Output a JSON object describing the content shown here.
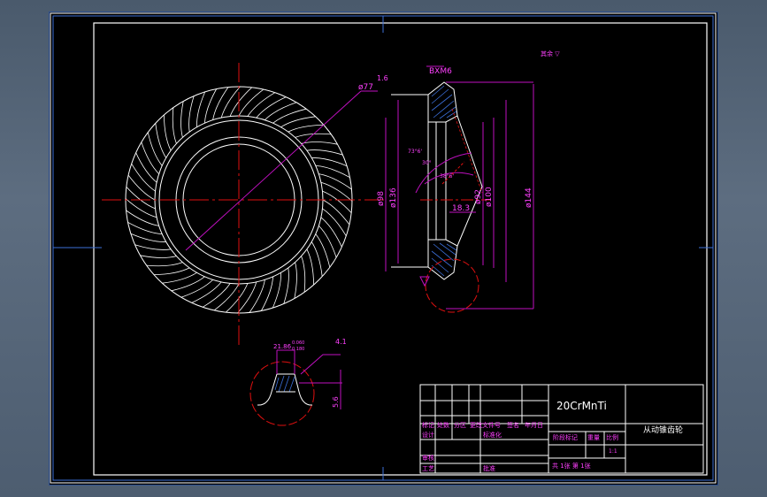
{
  "drawing": {
    "material": "20CrMnTi",
    "part_name": "从动锥齿轮",
    "tech_note": "其余 ▽",
    "surface_finish_top": "1.6",
    "chamfer": "BXM6"
  },
  "dims": {
    "d77": "ø77",
    "d98": "ø98",
    "d136": "ø136",
    "d92": "ø92",
    "d100": "ø100",
    "d144": "ø144",
    "w18": "18.3",
    "a1": "73°6'",
    "a2": "30°",
    "a3": "38°6'",
    "tooth_w": "21.86",
    "tol_up": "0.060",
    "tol_dn": "0.180",
    "d41": "4.1",
    "d56": "5.6"
  },
  "title_block": {
    "row1": [
      "标记",
      "处数",
      "分区",
      "更改文件号",
      "签名",
      "年月日"
    ],
    "row2": [
      "设计",
      "",
      "",
      "标准化"
    ],
    "mid": [
      "阶段标记",
      "重量",
      "比例"
    ],
    "scale": "1:1",
    "row3": [
      "审核",
      "",
      "",
      "",
      "",
      ""
    ],
    "row4": [
      "工艺",
      "",
      "批准"
    ],
    "sheets": "共 1张 第 1张"
  }
}
